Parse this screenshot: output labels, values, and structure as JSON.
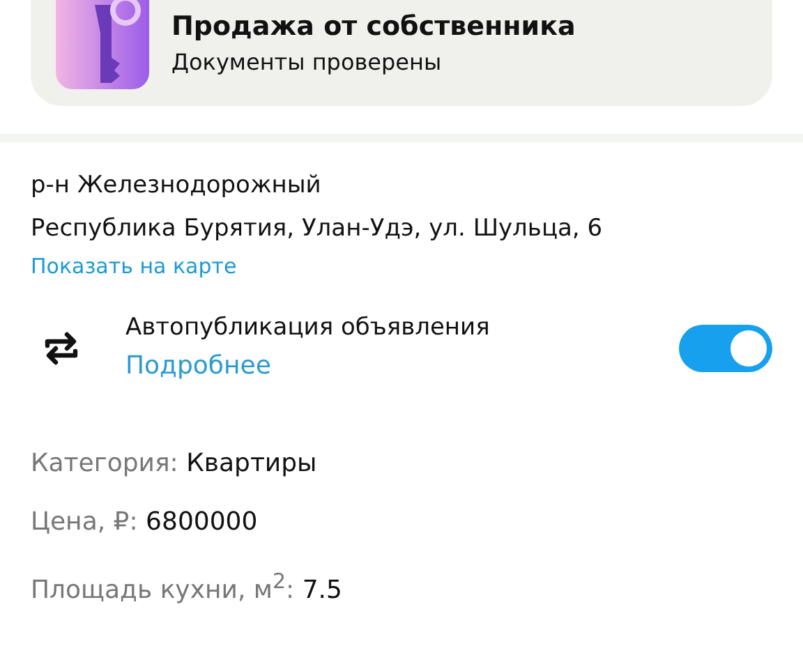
{
  "owner_card": {
    "title": "Продажа от собственника",
    "subtitle": "Документы проверены"
  },
  "address": {
    "district": "р-н Железнодорожный",
    "street": "Республика Бурятия, Улан-Удэ, ул. Шульца, 6",
    "map_link": "Показать на карте"
  },
  "autopublish": {
    "title": "Автопубликация объявления",
    "link": "Подробнее",
    "on": true
  },
  "details": [
    {
      "label": "Категория:",
      "value": "Квартиры"
    },
    {
      "label": "Цена, ₽:",
      "value": "6800000"
    },
    {
      "label": "Площадь кухни, м$^{2}$:",
      "value": "7.5"
    }
  ]
}
